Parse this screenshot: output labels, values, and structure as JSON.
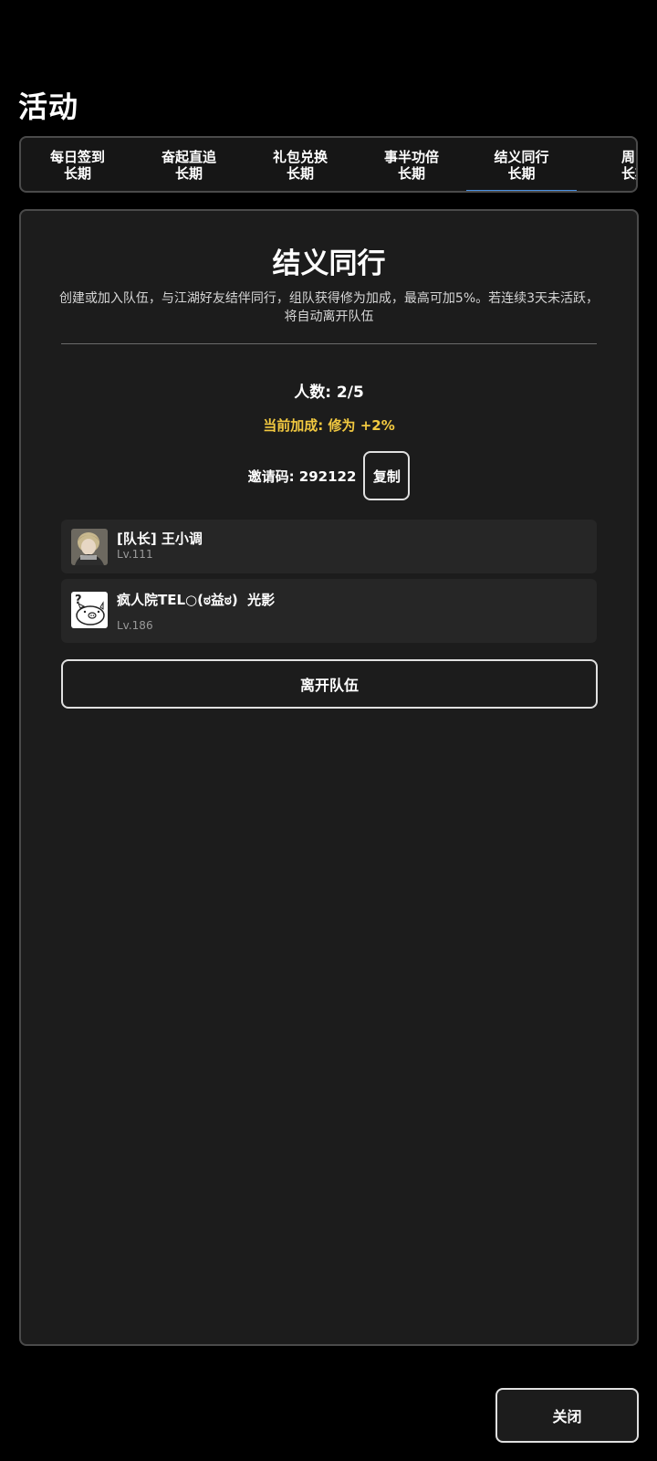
{
  "page": {
    "title": "活动"
  },
  "tabs": [
    {
      "name": "每日签到",
      "sub": "长期",
      "active": false
    },
    {
      "name": "奋起直追",
      "sub": "长期",
      "active": false
    },
    {
      "name": "礼包兑换",
      "sub": "长期",
      "active": false
    },
    {
      "name": "事半功倍",
      "sub": "长期",
      "active": false
    },
    {
      "name": "结义同行",
      "sub": "长期",
      "active": true
    },
    {
      "name": "周常",
      "sub": "长期",
      "active": false
    }
  ],
  "panel": {
    "title": "结义同行",
    "description": "创建或加入队伍，与江湖好友结伴同行，组队获得修为加成，最高可加5%。若连续3天未活跃，将自动离开队伍",
    "member_count": "人数: 2/5",
    "bonus": "当前加成: 修为 +2%",
    "invite_code_text": "邀请码: 292122",
    "copy_label": "复制",
    "members": [
      {
        "name": "[队长] 王小调",
        "level": "Lv.111",
        "avatar": "portrait-avatar"
      },
      {
        "name": "疯人院TEL○(ಠ益ಠ)  光影",
        "level": "Lv.186",
        "avatar": "pig-avatar"
      }
    ],
    "leave_label": "离开队伍"
  },
  "footer": {
    "close_label": "关闭"
  },
  "colors": {
    "background": "#000000",
    "panel": "#1c1c1c",
    "accent": "#4a90e2",
    "bonus": "#f2c940"
  }
}
